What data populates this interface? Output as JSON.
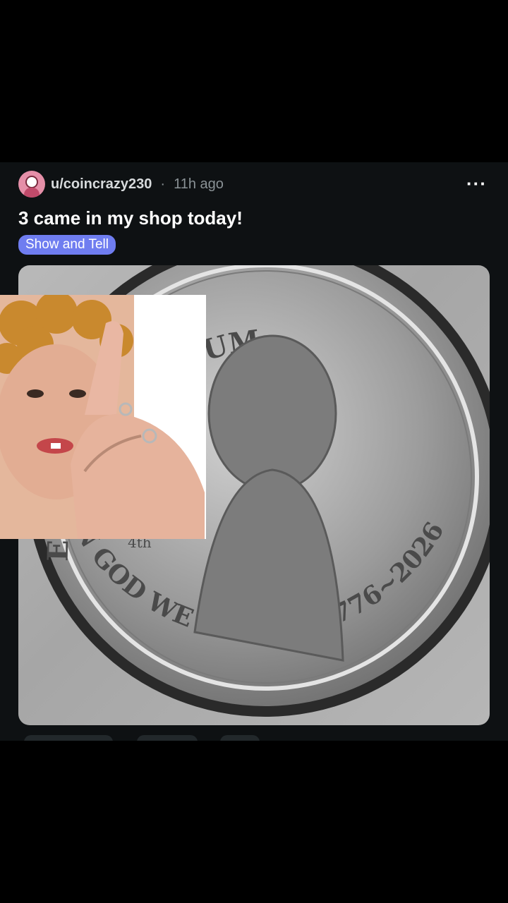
{
  "post": {
    "username": "u/coincrazy230",
    "separator": "·",
    "time": "11h ago",
    "title": "3 came in my shop today!",
    "flair": "Show and Tell",
    "more_icon": "more-horizontal-icon"
  },
  "coin": {
    "top_inscription": "E PLURIBUS UNUM",
    "bottom_inscription": "IN GOD WE TRUST · 1776~2026",
    "small_mark": "4th"
  },
  "colors": {
    "post_bg": "#0e1113",
    "flair_bg": "#6f7df0",
    "avatar_bg": "#e58fa8"
  }
}
